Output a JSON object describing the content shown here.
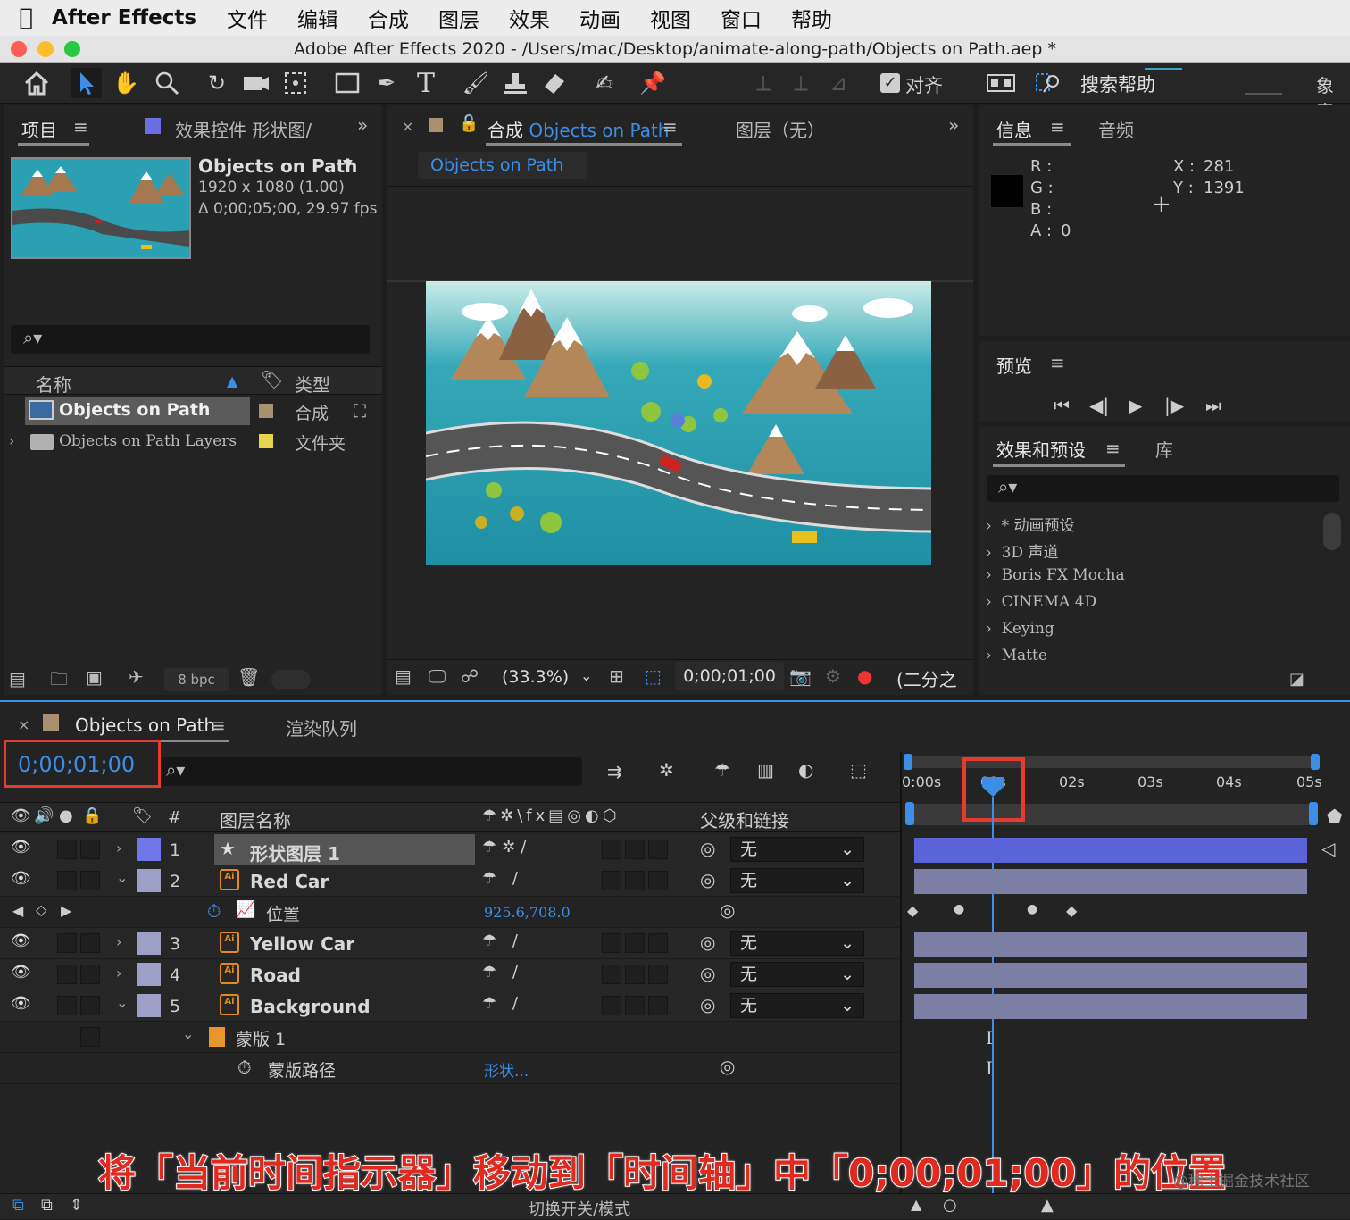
{
  "menubar": {
    "app": "After Effects",
    "items": [
      "文件",
      "编辑",
      "合成",
      "图层",
      "效果",
      "动画",
      "视图",
      "窗口",
      "帮助"
    ]
  },
  "window": {
    "title": "Adobe After Effects 2020 - /Users/mac/Desktop/animate-along-path/Objects on Path.aep *"
  },
  "toolbar": {
    "align_label": "对齐",
    "search_help": "搜索帮助",
    "workspace_partial": "象素"
  },
  "project_panel": {
    "tab_project": "项目",
    "tab_effects": "效果控件 形状图/",
    "comp_name": "Objects on Path",
    "comp_size": "1920 x 1080 (1.00)",
    "comp_duration": "Δ 0;00;05;00, 29.97 fps",
    "col_name": "名称",
    "col_type": "类型",
    "items": [
      {
        "name": "Objects on Path",
        "type": "合成",
        "color": "#a89070"
      },
      {
        "name": "Objects on Path Layers",
        "type": "文件夹",
        "color": "#e8d44d"
      }
    ],
    "bpc": "8 bpc"
  },
  "composition_panel": {
    "tab_label": "合成",
    "tab_comp": "Objects on Path",
    "tab_layer": "图层（无）",
    "breadcrumb": "Objects on Path",
    "zoom": "(33.3%)",
    "timecode": "0;00;01;00",
    "resolution": "(二分之一"
  },
  "info_panel": {
    "tab_info": "信息",
    "tab_audio": "音频",
    "r_label": "R :",
    "g_label": "G :",
    "b_label": "B :",
    "a_label": "A :",
    "a_value": "0",
    "x_label": "X :",
    "x_value": "281",
    "y_label": "Y :",
    "y_value": "1391"
  },
  "preview_panel": {
    "title": "预览"
  },
  "effects_panel": {
    "tab_effects": "效果和预设",
    "tab_library": "库",
    "items": [
      "* 动画预设",
      "3D 声道",
      "Boris FX Mocha",
      "CINEMA 4D",
      "Keying",
      "Matte"
    ]
  },
  "timeline": {
    "tab_comp": "Objects on Path",
    "tab_render": "渲染队列",
    "current_time": "0;00;01;00",
    "col_layer_name": "图层名称",
    "col_num": "#",
    "col_parent": "父级和链接",
    "ruler": [
      "0:00s",
      "01s",
      "02s",
      "03s",
      "04s",
      "05s"
    ],
    "layers": [
      {
        "num": "1",
        "name": "形状图层 1",
        "parent": "无",
        "color": "#6f77e8",
        "expanded": false
      },
      {
        "num": "2",
        "name": "Red Car",
        "parent": "无",
        "color": "#9d9fc7",
        "expanded": true
      },
      {
        "num": "3",
        "name": "Yellow Car",
        "parent": "无",
        "color": "#9d9fc7",
        "expanded": false
      },
      {
        "num": "4",
        "name": "Road",
        "parent": "无",
        "color": "#9d9fc7",
        "expanded": false
      },
      {
        "num": "5",
        "name": "Background",
        "parent": "无",
        "color": "#9d9fc7",
        "expanded": true
      }
    ],
    "position_prop": "位置",
    "position_value": "925.6,708.0",
    "mask_name": "蒙版 1",
    "mask_path_prop": "蒙版路径",
    "mask_path_value": "形状...",
    "footer_toggle": "切换开关/模式"
  },
  "caption": {
    "text": "将「当前时间指示器」移动到「时间轴」中「0;00;01;00」的位置",
    "watermark": "@稀土掘金技术社区"
  },
  "colors": {
    "accent_blue": "#3d8ee6",
    "highlight_red": "#e53c2f",
    "caption_red": "#e02a1f",
    "layer1_bar": "#5a63d8",
    "layer_bar": "#7c7ea6"
  }
}
